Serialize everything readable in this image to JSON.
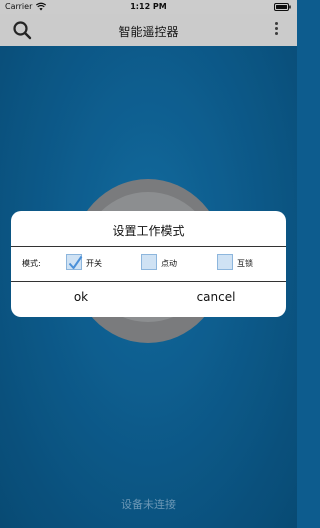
{
  "status_bar": {
    "carrier": "Carrier",
    "time": "1:12 PM"
  },
  "nav": {
    "title": "智能遥控器"
  },
  "dialog": {
    "title": "设置工作模式",
    "mode_label": "模式:",
    "options": [
      {
        "label": "开关",
        "checked": true
      },
      {
        "label": "点动",
        "checked": false
      },
      {
        "label": "互锁",
        "checked": false
      }
    ],
    "ok_label": "ok",
    "cancel_label": "cancel"
  },
  "footer": {
    "status": "设备未连接"
  },
  "colors": {
    "background": "#0f689f",
    "checkbox_fill": "#cfe2f4",
    "check_mark": "#4a90d9"
  }
}
